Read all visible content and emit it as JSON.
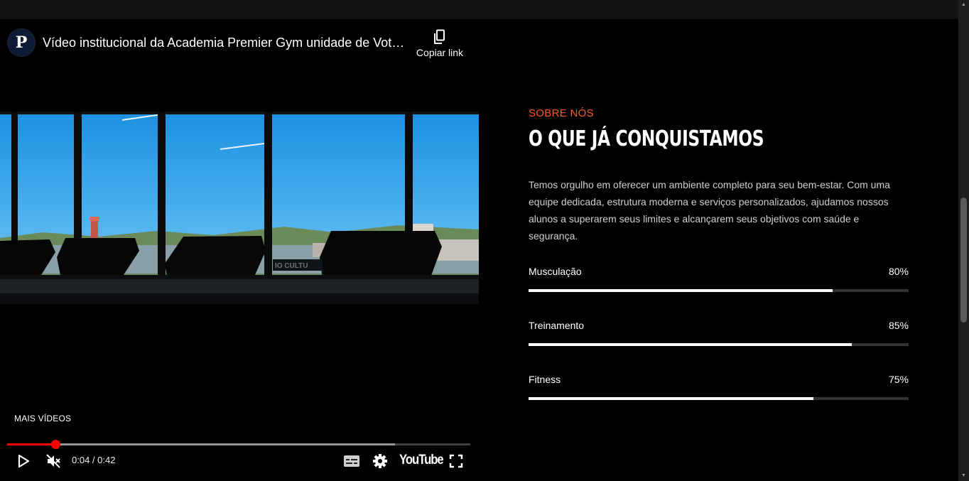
{
  "player": {
    "channel_initial": "P",
    "title": "Vídeo institucional da Academia Premier Gym unidade de Votorantim",
    "copy_link_label": "Copiar link",
    "more_videos_label": "MAIS VÍDEOS",
    "current_time": "0:04",
    "time_separator": " / ",
    "duration": "0:42",
    "progress_fraction": 0.105,
    "buffer_fraction": 0.838,
    "youtube_logo": "YouTube",
    "icons": {
      "copy": "copy-icon",
      "play": "play-icon",
      "mute": "volume-muted-icon",
      "subtitles": "subtitles-icon",
      "settings": "gear-icon",
      "fullscreen": "fullscreen-icon"
    },
    "progress_color": "#ff0000"
  },
  "about": {
    "eyebrow": "SOBRE NÓS",
    "heading": "O QUE JÁ CONQUISTAMOS",
    "description": "Temos orgulho em oferecer um ambiente completo para seu bem-estar. Com uma equipe dedicada, estrutura moderna e serviços personalizados, ajudamos nossos alunos a superarem seus limites e alcançarem seus objetivos com saúde e segurança.",
    "accent_color": "#ff5722",
    "skills": [
      {
        "name": "Musculação",
        "percent_label": "80%",
        "value": 80
      },
      {
        "name": "Treinamento",
        "percent_label": "85%",
        "value": 85
      },
      {
        "name": "Fitness",
        "percent_label": "75%",
        "value": 75
      }
    ]
  }
}
